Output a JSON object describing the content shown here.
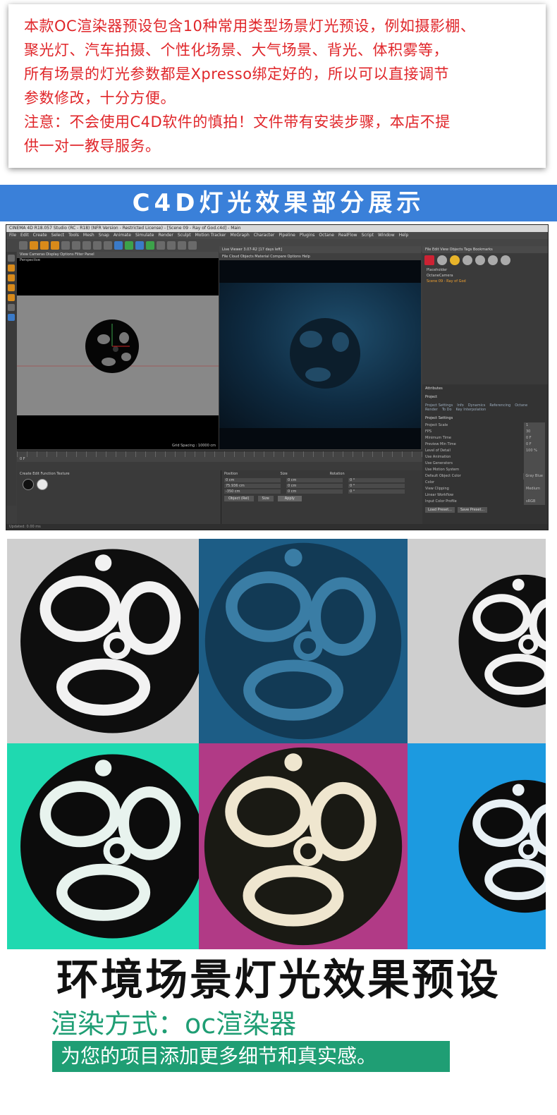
{
  "notice": {
    "lines": [
      "本款OC渲染器预设包含10种常用类型场景灯光预设，例如摄影棚、",
      "聚光灯、汽车拍摄、个性化场景、大气场景、背光、体积雾等，",
      "所有场景的灯光参数都是Xpresso绑定好的，所以可以直接调节",
      "参数修改，十分方便。",
      "注意：不会使用C4D软件的慎拍！文件带有安装步骤，本店不提",
      "供一对一教导服务。"
    ],
    "color": "#e0262a"
  },
  "banner": {
    "title": "C4D灯光效果部分展示",
    "color": "#3a80d9"
  },
  "c4d": {
    "title": "CINEMA 4D R18.057 Studio (RC - R18) (NFR Version - Restricted License) - [Scene 09 - Ray of God.c4d] - Main",
    "menu": [
      "File",
      "Edit",
      "Create",
      "Select",
      "Tools",
      "Mesh",
      "Snap",
      "Animate",
      "Simulate",
      "Render",
      "Sculpt",
      "Motion Tracker",
      "MoGraph",
      "Character",
      "Pipeline",
      "Plugins",
      "Octane",
      "RealFlow",
      "Script",
      "Window",
      "Help"
    ],
    "left_viewport_menu": "View  Cameras  Display  Options  Filter  Panel",
    "left_viewport_label": "Perspective",
    "grid_spacing": "Grid Spacing : 10000 cm",
    "right_viewport_title": "Live Viewer 3.07-R2 [17 days left]",
    "right_viewport_menu": "File  Cloud  Objects  Material  Compare  Options  Help",
    "objects": [
      "Placeholder",
      "OctaneCamera",
      "Scene 09 - Ray of God"
    ],
    "attributes_title": "Attributes",
    "attributes_section": "Project",
    "attributes_tabs": [
      "Project Settings",
      "Info",
      "Dynamics",
      "Referencing",
      "Octane Render",
      "To Do",
      "Key Interpolation"
    ],
    "project_settings_label": "Project Settings",
    "attribute_fields": [
      "Project Scale",
      "FPS",
      "Minimum Time",
      "Preview Min Time",
      "Level of Detail",
      "Use Animation",
      "Use Generators",
      "Use Motion System",
      "Default Object Color",
      "Color",
      "View Clipping",
      "Linear Workflow",
      "Input Color Profile"
    ],
    "attribute_values": [
      "1",
      "30",
      "0 F",
      "0 F",
      "100 %",
      "",
      "",
      "",
      "Gray Blue",
      "",
      "Medium",
      "",
      "sRGB"
    ],
    "attribute_buttons": [
      "Load Preset...",
      "Save Preset..."
    ],
    "bottom_menu": "Create  Edit  Function  Texture",
    "coord_headers": [
      "Position",
      "Size",
      "Rotation"
    ],
    "coord_rows": [
      {
        "pos": "0 cm",
        "size": "0 cm",
        "rot": "0 °"
      },
      {
        "pos": "75.936 cm",
        "size": "0 cm",
        "rot": "0 °"
      },
      {
        "pos": "-350 cm",
        "size": "0 cm",
        "rot": "0 °"
      }
    ],
    "coord_dropdowns": [
      "Object (Rel)",
      "Size"
    ],
    "apply_button": "Apply",
    "frame_display": "0 F",
    "status": "Updated: 0.00 ms"
  },
  "renders": [
    {
      "bg": "#cfcfcf",
      "ball": "#0e0e0e",
      "ring": "#f2f2f2"
    },
    {
      "bg": "#1d5d86",
      "ball": "#123a55",
      "ring": "#3a7da5"
    },
    {
      "bg": "#cfcfcf",
      "ball": "#0e0e0e",
      "ring": "#f2f2f2"
    },
    {
      "bg": "#1fd9b0",
      "ball": "#0c0c0c",
      "ring": "#e8f3ee"
    },
    {
      "bg": "#b13a86",
      "ball": "#1a1a14",
      "ring": "#efe6cf"
    },
    {
      "bg": "#1c9ae0",
      "ball": "#0c0c0c",
      "ring": "#e9f1f5"
    }
  ],
  "footer": {
    "title": "环境场景灯光效果预设",
    "render_mode": "渲染方式：oc渲染器",
    "tagline": "为您的项目添加更多细节和真实感。",
    "accent": "#1f9e74"
  }
}
